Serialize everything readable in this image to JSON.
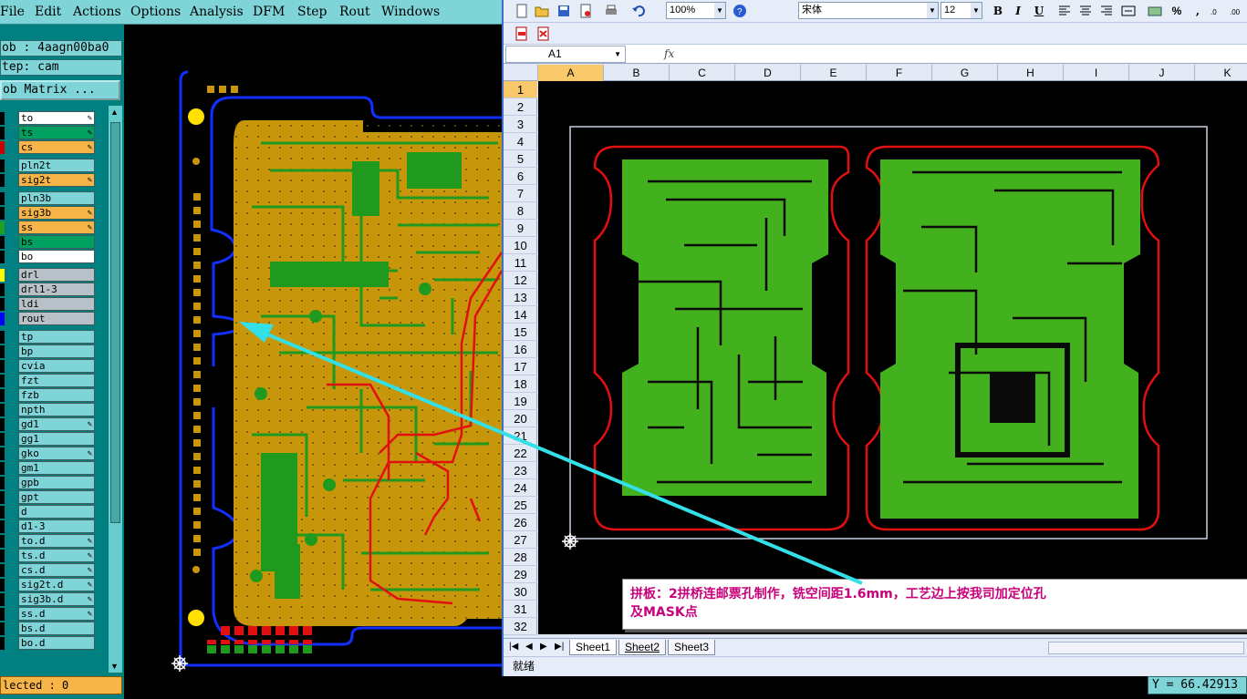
{
  "cam": {
    "menu": [
      "File",
      "Edit",
      "Actions",
      "Options",
      "Analysis",
      "DFM",
      "Step",
      "Rout",
      "Windows"
    ],
    "job": "ob : 4aagn00ba0",
    "step": "tep: cam",
    "matrix_button": "ob Matrix ...",
    "layers": [
      {
        "name": "to",
        "bg": "#ffffff",
        "sw": "#000000",
        "edit": true
      },
      {
        "name": "ts",
        "bg": "#00a060",
        "sw": "#000000",
        "edit": true
      },
      {
        "name": "cs",
        "bg": "#f7b548",
        "sw": "#cc0000",
        "edit": true
      },
      {
        "name": "pln2t",
        "bg": "#7fd4d8",
        "sw": "#000000",
        "edit": false
      },
      {
        "name": "sig2t",
        "bg": "#f7b548",
        "sw": "#000000",
        "edit": true
      },
      {
        "name": "pln3b",
        "bg": "#7fd4d8",
        "sw": "#000000",
        "edit": false
      },
      {
        "name": "sig3b",
        "bg": "#f7b548",
        "sw": "#000000",
        "edit": true
      },
      {
        "name": "ss",
        "bg": "#f7b548",
        "sw": "#20a020",
        "edit": true
      },
      {
        "name": "bs",
        "bg": "#00a060",
        "sw": "#000000",
        "edit": false
      },
      {
        "name": "bo",
        "bg": "#ffffff",
        "sw": "#000000",
        "edit": false
      },
      {
        "name": "drl",
        "bg": "#b8c0c8",
        "sw": "#ffff00",
        "edit": false
      },
      {
        "name": "drl1-3",
        "bg": "#b8c0c8",
        "sw": "#000000",
        "edit": false
      },
      {
        "name": "ldi",
        "bg": "#b8c0c8",
        "sw": "#000000",
        "edit": false
      },
      {
        "name": "rout",
        "bg": "#b8c0c8",
        "sw": "#0000ff",
        "edit": false
      },
      {
        "name": "tp",
        "bg": "#7fd4d8",
        "sw": "#000000",
        "edit": false
      },
      {
        "name": "bp",
        "bg": "#7fd4d8",
        "sw": "#000000",
        "edit": false
      },
      {
        "name": "cvia",
        "bg": "#7fd4d8",
        "sw": "#000000",
        "edit": false
      },
      {
        "name": "fzt",
        "bg": "#7fd4d8",
        "sw": "#000000",
        "edit": false
      },
      {
        "name": "fzb",
        "bg": "#7fd4d8",
        "sw": "#000000",
        "edit": false
      },
      {
        "name": "npth",
        "bg": "#7fd4d8",
        "sw": "#000000",
        "edit": false
      },
      {
        "name": "gd1",
        "bg": "#7fd4d8",
        "sw": "#000000",
        "edit": true
      },
      {
        "name": "gg1",
        "bg": "#7fd4d8",
        "sw": "#000000",
        "edit": false
      },
      {
        "name": "gko",
        "bg": "#7fd4d8",
        "sw": "#000000",
        "edit": true
      },
      {
        "name": "gm1",
        "bg": "#7fd4d8",
        "sw": "#000000",
        "edit": false
      },
      {
        "name": "gpb",
        "bg": "#7fd4d8",
        "sw": "#000000",
        "edit": false
      },
      {
        "name": "gpt",
        "bg": "#7fd4d8",
        "sw": "#000000",
        "edit": false
      },
      {
        "name": "d",
        "bg": "#7fd4d8",
        "sw": "#000000",
        "edit": false
      },
      {
        "name": "d1-3",
        "bg": "#7fd4d8",
        "sw": "#000000",
        "edit": false
      },
      {
        "name": "to.d",
        "bg": "#7fd4d8",
        "sw": "#000000",
        "edit": true
      },
      {
        "name": "ts.d",
        "bg": "#7fd4d8",
        "sw": "#000000",
        "edit": true
      },
      {
        "name": "cs.d",
        "bg": "#7fd4d8",
        "sw": "#000000",
        "edit": true
      },
      {
        "name": "sig2t.d",
        "bg": "#7fd4d8",
        "sw": "#000000",
        "edit": true
      },
      {
        "name": "sig3b.d",
        "bg": "#7fd4d8",
        "sw": "#000000",
        "edit": true
      },
      {
        "name": "ss.d",
        "bg": "#7fd4d8",
        "sw": "#000000",
        "edit": true
      },
      {
        "name": "bs.d",
        "bg": "#7fd4d8",
        "sw": "#000000",
        "edit": false
      },
      {
        "name": "bo.d",
        "bg": "#7fd4d8",
        "sw": "#000000",
        "edit": false
      }
    ],
    "selected": "lected : 0",
    "y_coord": "Y = 66.42913"
  },
  "excel": {
    "zoom": "100%",
    "font": "宋体",
    "size": "12",
    "bold": "B",
    "italic": "I",
    "underline": "U",
    "percent": "%",
    "comma": ",",
    "name_box": "A1",
    "fx": "fx",
    "columns": [
      "A",
      "B",
      "C",
      "D",
      "E",
      "F",
      "G",
      "H",
      "I",
      "J",
      "K"
    ],
    "rows": [
      "1",
      "2",
      "3",
      "4",
      "5",
      "6",
      "7",
      "8",
      "9",
      "10",
      "11",
      "12",
      "13",
      "14",
      "15",
      "16",
      "17",
      "18",
      "19",
      "20",
      "21",
      "22",
      "23",
      "24",
      "25",
      "26",
      "27",
      "28",
      "29",
      "30",
      "31",
      "32"
    ],
    "sheets": [
      "Sheet1",
      "Sheet2",
      "Sheet3"
    ],
    "status": "就绪",
    "note_line1": "拼板：2拼桥连邮票孔制作，铣空间距1.6mm，工艺边上按我司加定位孔",
    "note_line2": "及MASK点"
  },
  "colors": {
    "accent_teal": "#7fd4d8",
    "arrow": "#33e0e8",
    "note_text": "#c8007a",
    "board_green": "#1f9a1f",
    "board_gold": "#c8960a",
    "rout_blue": "#1030ff",
    "outline_red": "#e01010"
  }
}
